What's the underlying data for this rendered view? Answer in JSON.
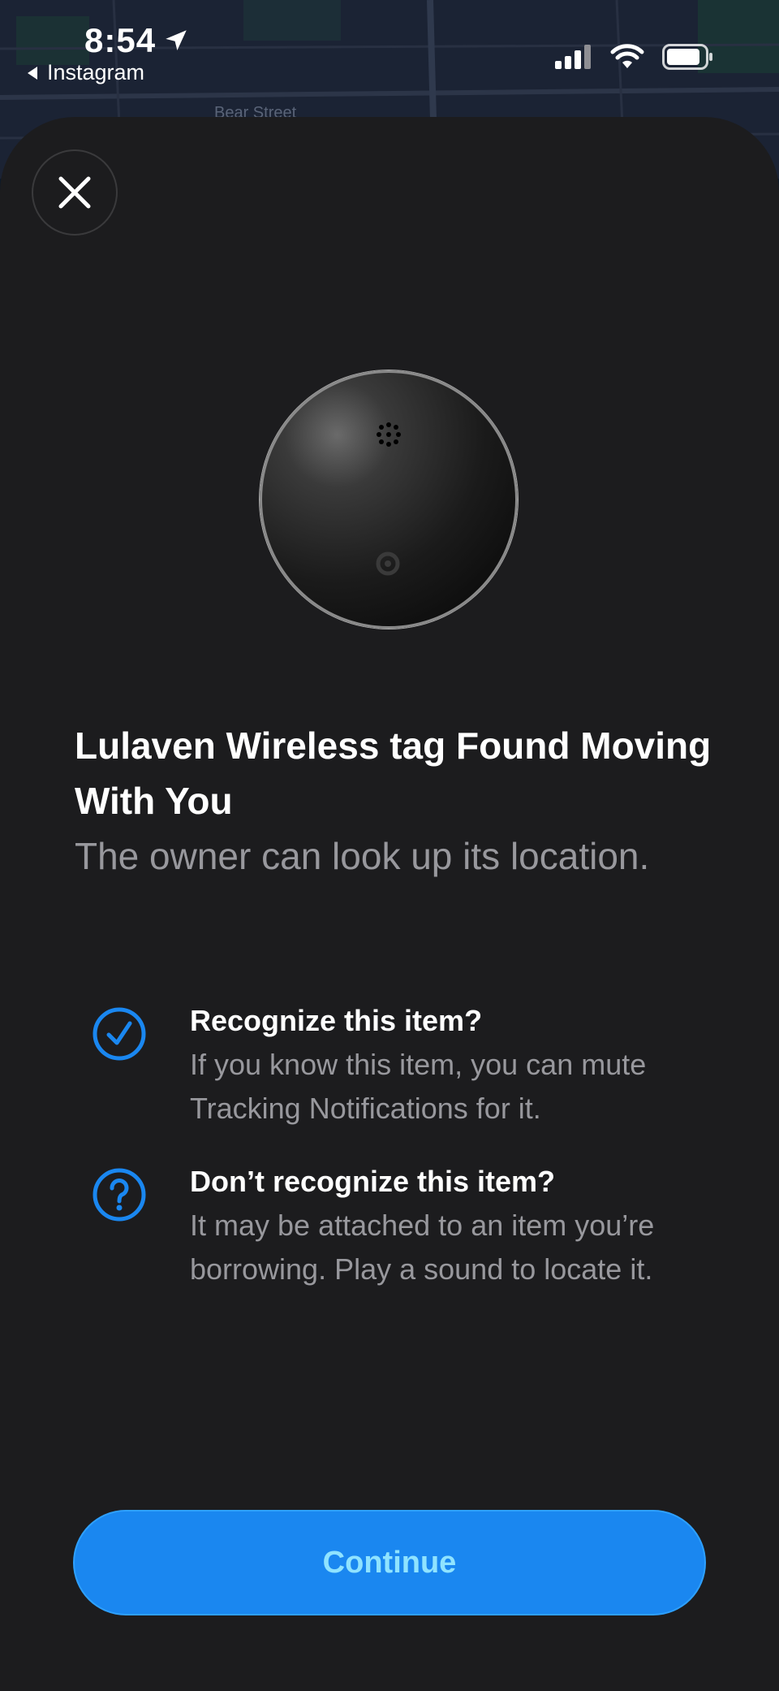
{
  "status_bar": {
    "time": "8:54",
    "back_app": "Instagram"
  },
  "map": {
    "label": "Bear Street"
  },
  "header": {
    "title": "Lulaven Wireless tag Found Moving With You",
    "subtitle": "The owner can look up its location."
  },
  "items": [
    {
      "icon": "checkmark-circle-icon",
      "heading": "Recognize this item?",
      "body": "If you know this item, you can mute Tracking Notifications for it."
    },
    {
      "icon": "question-circle-icon",
      "heading": "Don’t recognize this item?",
      "body": "It may be attached to an item you’re borrowing. Play a sound to locate it."
    }
  ],
  "actions": {
    "continue_label": "Continue"
  },
  "colors": {
    "accent": "#1a87f0",
    "sheet_bg": "#1c1c1e",
    "secondary_text": "#98989d"
  }
}
